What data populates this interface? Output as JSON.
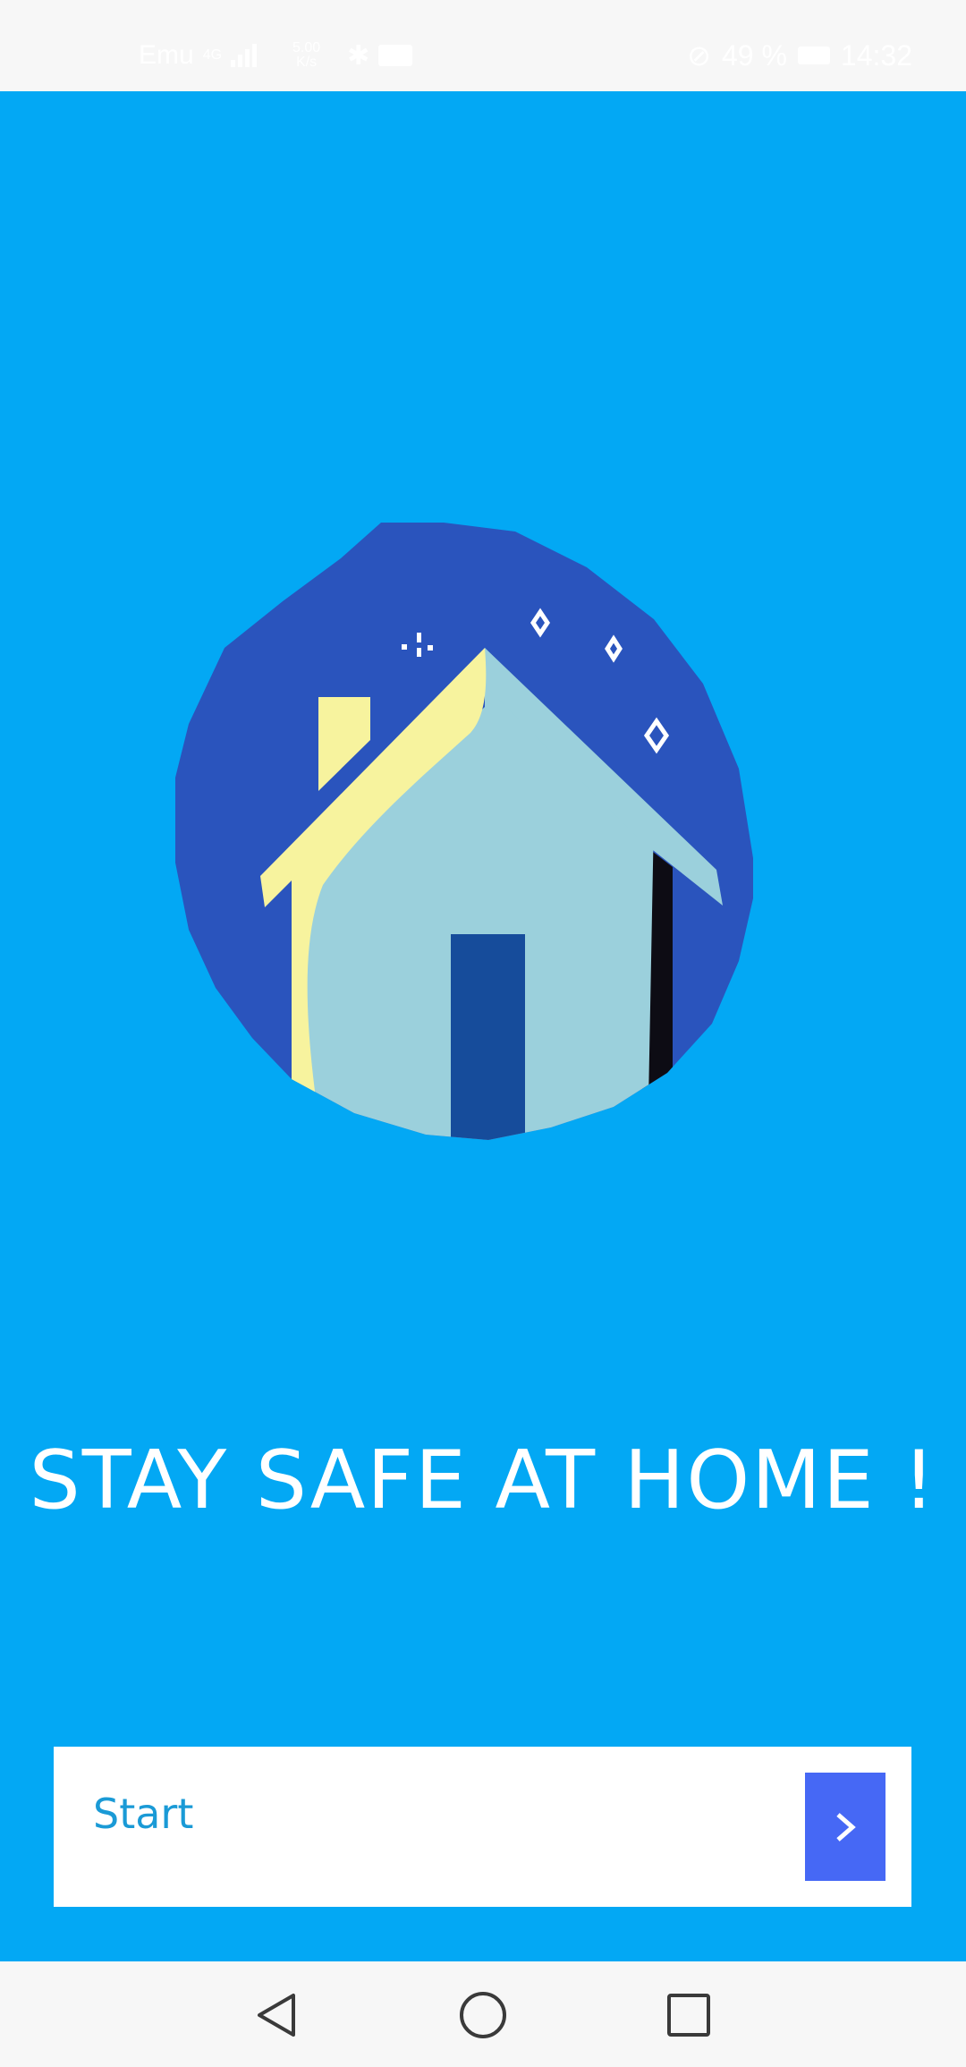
{
  "status_bar": {
    "carrier": "Emu",
    "network_small": "4G",
    "speed_top": "5.00",
    "speed_bottom": "K/s",
    "battery_percent": "49 %",
    "time": "14:32",
    "icons": [
      "signal-icon",
      "bluetooth-icon",
      "mail-icon",
      "alarm-off-icon",
      "battery-icon"
    ]
  },
  "main": {
    "background_color": "#03a8f4",
    "headline": "STAY SAFE AT HOME !",
    "illustration": "house-icon",
    "start_button": {
      "label": "Start",
      "arrow_icon": "chevron-right-icon",
      "arrow_color": "#4668f5"
    }
  },
  "nav_bar": {
    "buttons": [
      "back-icon",
      "home-icon",
      "recents-icon"
    ]
  }
}
